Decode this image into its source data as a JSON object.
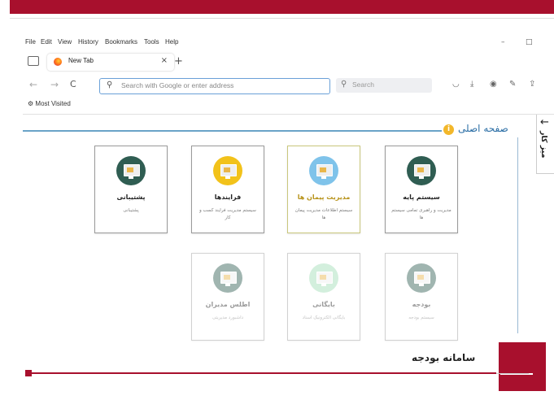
{
  "menu": [
    "File",
    "Edit",
    "View",
    "History",
    "Bookmarks",
    "Tools",
    "Help"
  ],
  "window_controls": {
    "minimize": "–",
    "maximize": "□"
  },
  "tab": {
    "label": "New Tab",
    "close": "×",
    "new_tab": "+"
  },
  "nav": {
    "back": "←",
    "forward": "→",
    "reload": "C"
  },
  "url_placeholder": "Search with Google or enter address",
  "search_placeholder": "Search",
  "toolbar_icons": [
    "pocket-icon",
    "download-icon",
    "account-icon",
    "extensions-icon",
    "share-icon"
  ],
  "bookmarks": {
    "most_visited": "Most Visited"
  },
  "page": {
    "home_link": "صفحه اصلی",
    "side_label": "میز کار"
  },
  "cards": [
    {
      "title": "سیستم پایه",
      "desc": "مدیریت و راهبری تمامی سیستم ها",
      "color": "#2f5d52"
    },
    {
      "title": "مدیریت پیمان ها",
      "desc": "سیستم اطلاعات مدیریت پیمان ها",
      "color": "#7fc3ea"
    },
    {
      "title": "فرایندها",
      "desc": "سیستم مدیریت فرایند کسب و کار",
      "color": "#f2c21a"
    },
    {
      "title": "پشتیبانی",
      "desc": "پشتیبانی",
      "color": "#2f5d52"
    },
    {
      "title": "بودجه",
      "desc": "سیستم بودجه",
      "color": "#2f5d52"
    },
    {
      "title": "بایگانی",
      "desc": "بایگانی الکترونیک اسناد",
      "color": "#9fdcb5"
    },
    {
      "title": "اطلس مدیران",
      "desc": "داشبورد مدیریتی",
      "color": "#2f5d52"
    }
  ],
  "overlay": {
    "caption": "سامانه بودجه",
    "accent": "#a8102d",
    "progress": 0.94
  }
}
